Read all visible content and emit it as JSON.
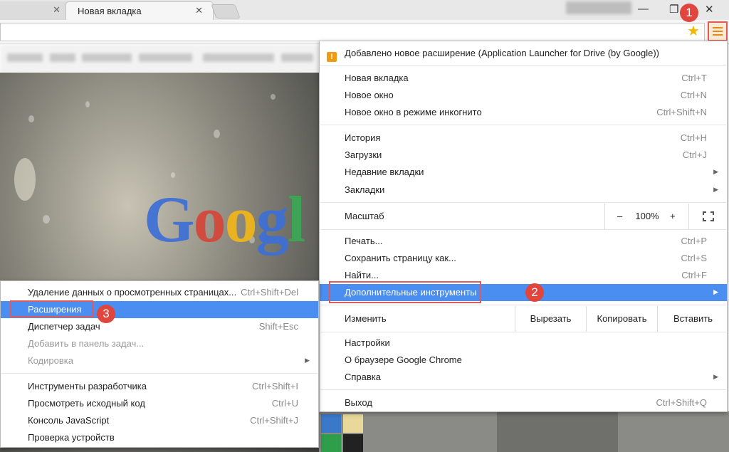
{
  "tabs": {
    "active_title": "Новая вкладка",
    "close_glyph": "✕"
  },
  "window_controls": {
    "minimize": "—",
    "restore": "❐",
    "close": "✕"
  },
  "background_logo": {
    "letters": [
      {
        "ch": "G",
        "color": "#3d6fd6"
      },
      {
        "ch": "o",
        "color": "#d64538"
      },
      {
        "ch": "o",
        "color": "#f1b619"
      },
      {
        "ch": "g",
        "color": "#3d6fd6"
      },
      {
        "ch": "l",
        "color": "#3ba853"
      }
    ]
  },
  "main_menu": {
    "notification": {
      "icon": "warning-icon",
      "icon_glyph": "!",
      "label": "Добавлено новое расширение (Application Launcher for Drive (by Google))"
    },
    "items": [
      {
        "label": "Новая вкладка",
        "shortcut": "Ctrl+T"
      },
      {
        "label": "Новое окно",
        "shortcut": "Ctrl+N"
      },
      {
        "label": "Новое окно в режиме инкогнито",
        "shortcut": "Ctrl+Shift+N"
      },
      {
        "label": "История",
        "shortcut": "Ctrl+H"
      },
      {
        "label": "Загрузки",
        "shortcut": "Ctrl+J"
      },
      {
        "label": "Недавние вкладки",
        "arrow": "▶"
      },
      {
        "label": "Закладки",
        "arrow": "▶"
      },
      {
        "label": "Печать...",
        "shortcut": "Ctrl+P"
      },
      {
        "label": "Сохранить страницу как...",
        "shortcut": "Ctrl+S"
      },
      {
        "label": "Найти...",
        "shortcut": "Ctrl+F"
      },
      {
        "label": "Дополнительные инструменты",
        "arrow": "▶"
      },
      {
        "label": "Настройки"
      },
      {
        "label": "О браузере Google Chrome"
      },
      {
        "label": "Справка",
        "arrow": "▶"
      },
      {
        "label": "Выход",
        "shortcut": "Ctrl+Shift+Q"
      }
    ],
    "zoom": {
      "label": "Масштаб",
      "minus": "–",
      "value": "100%",
      "plus": "+"
    },
    "edit": {
      "label": "Изменить",
      "cut": "Вырезать",
      "copy": "Копировать",
      "paste": "Вставить"
    }
  },
  "sub_menu": {
    "items": [
      {
        "label": "Удаление данных о просмотренных страницах...",
        "shortcut": "Ctrl+Shift+Del"
      },
      {
        "label": "Расширения"
      },
      {
        "label": "Диспетчер задач",
        "shortcut": "Shift+Esc"
      },
      {
        "label": "Добавить в панель задач..."
      },
      {
        "label": "Кодировка",
        "arrow": "▶"
      },
      {
        "label": "Инструменты разработчика",
        "shortcut": "Ctrl+Shift+I"
      },
      {
        "label": "Просмотреть исходный код",
        "shortcut": "Ctrl+U"
      },
      {
        "label": "Консоль JavaScript",
        "shortcut": "Ctrl+Shift+J"
      },
      {
        "label": "Проверка устройств"
      }
    ]
  },
  "annotations": {
    "step1": "1",
    "step2": "2",
    "step3": "3"
  },
  "colors": {
    "highlight": "#4b8ef1",
    "annotation_red": "#e05a5a",
    "badge_red": "#e0463e"
  }
}
